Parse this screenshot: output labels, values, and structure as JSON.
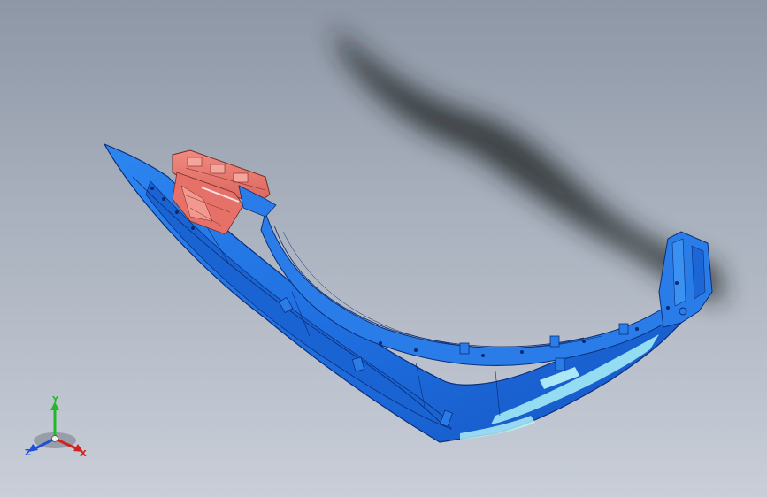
{
  "viewport": {
    "background_top": "#8e97a6",
    "background_bottom": "#c9ced8",
    "model": {
      "body_color": "#1f6fe0",
      "body_dark": "#0f3f9a",
      "bracket_color": "#e8766c",
      "highlight_color": "#a9f2f8"
    }
  },
  "triad": {
    "x_label": "X",
    "y_label": "Y",
    "z_label": "Z",
    "x_color": "#d62020",
    "y_color": "#22b82a",
    "z_color": "#2050d6"
  }
}
